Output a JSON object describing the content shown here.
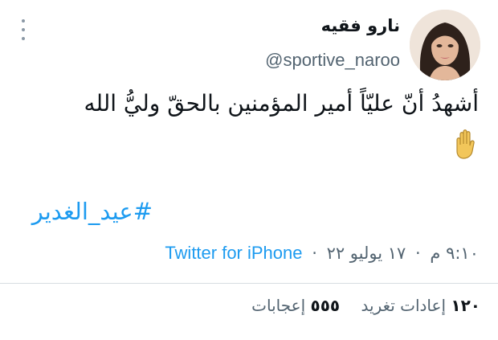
{
  "user": {
    "display_name": "نارو فقيه",
    "handle": "@sportive_naroo"
  },
  "tweet": {
    "text": "أشهدُ أنّ عليّاً أمير المؤمنين بالحقّ وليُّ الله",
    "emoji_icon": "raised-hand-icon",
    "hashtag": "#عيد_الغدير"
  },
  "meta": {
    "time": "٩:١٠ م",
    "separator": "·",
    "date": "١٧ يوليو ٢٢",
    "source": "Twitter for iPhone"
  },
  "stats": {
    "retweets_count": "١٢٠",
    "retweets_label": "إعادات تغريد",
    "likes_count": "٥٥٥",
    "likes_label": "إعجابات"
  },
  "colors": {
    "link": "#1d9bf0",
    "secondary_text": "#536471",
    "primary_text": "#0f1419",
    "divider": "#d7dde1"
  }
}
